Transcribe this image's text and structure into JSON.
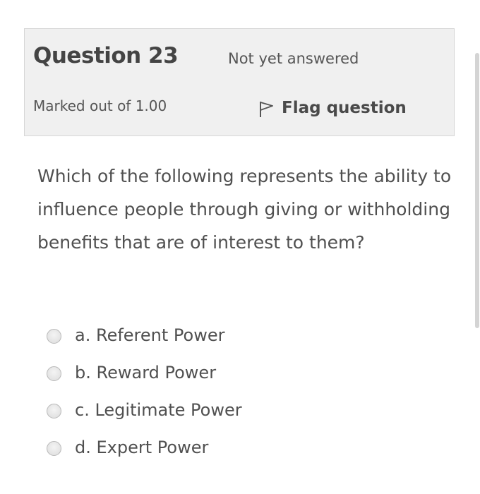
{
  "question": {
    "label": "Question",
    "number": "23",
    "state": "Not yet answered",
    "marks": "Marked out of 1.00",
    "flag_label": "Flag question",
    "flag_icon": "flag-icon",
    "text": "Which of the following represents the ability to influence people through giving or withholding benefits that are of interest to them?"
  },
  "answers": [
    {
      "label": "a. Referent Power"
    },
    {
      "label": "b. Reward Power"
    },
    {
      "label": "c. Legitimate Power"
    },
    {
      "label": "d. Expert Power"
    }
  ]
}
